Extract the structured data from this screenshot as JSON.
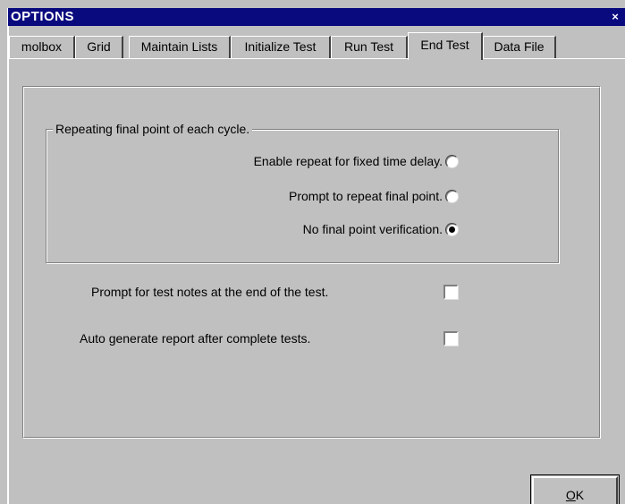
{
  "window": {
    "title": "OPTIONS",
    "close_glyph": "×"
  },
  "tabs": [
    {
      "label": "molbox",
      "active": false
    },
    {
      "label": "Grid",
      "active": false
    },
    {
      "label": "Maintain Lists",
      "active": false
    },
    {
      "label": "Initialize Test",
      "active": false
    },
    {
      "label": "Run Test",
      "active": false
    },
    {
      "label": "End Test",
      "active": true
    },
    {
      "label": "Data File",
      "active": false
    }
  ],
  "repeat_group": {
    "label": "Repeating final point of each cycle.",
    "options": [
      {
        "label": "Enable repeat for fixed time delay.",
        "selected": false
      },
      {
        "label": "Prompt to repeat final point.",
        "selected": false
      },
      {
        "label": "No final point verification.",
        "selected": true
      }
    ]
  },
  "checkboxes": [
    {
      "label": "Prompt for test notes at the end of the test.",
      "checked": false
    },
    {
      "label": "Auto generate report after complete tests.",
      "checked": false
    }
  ],
  "buttons": {
    "ok_mnemonic": "O",
    "ok_rest": "K"
  },
  "icons": {
    "close": "close-icon"
  }
}
